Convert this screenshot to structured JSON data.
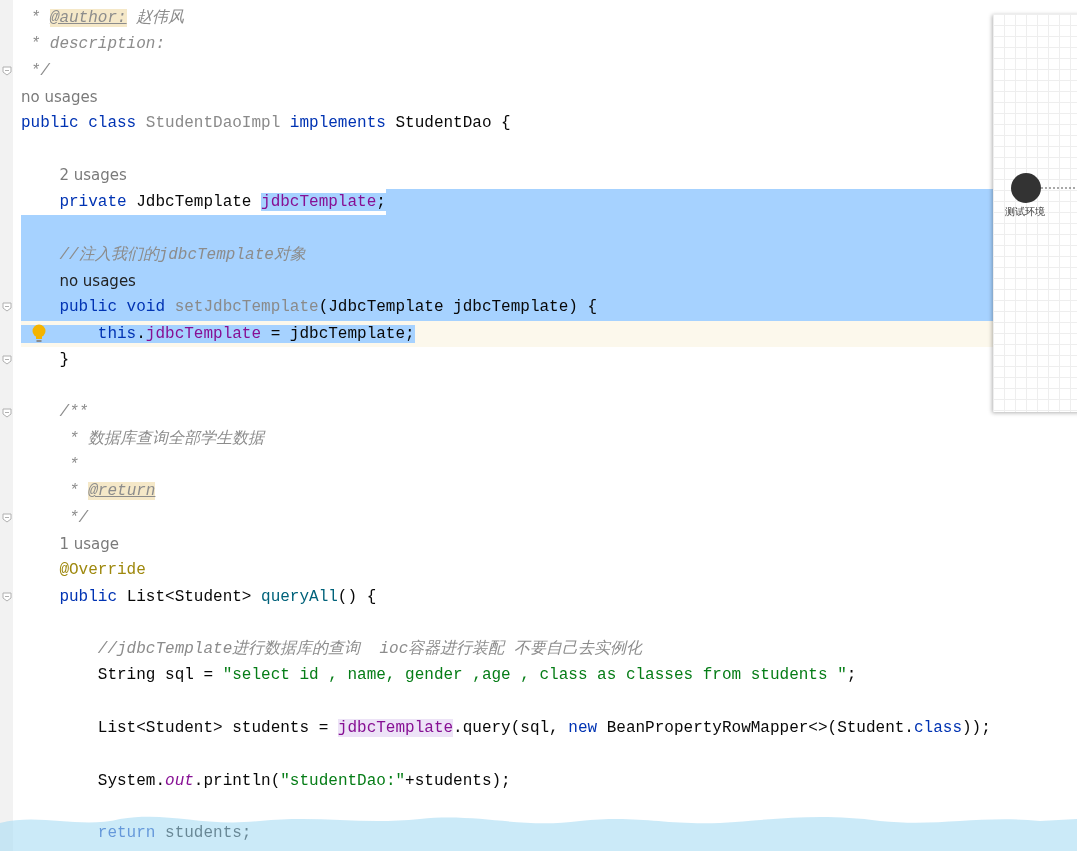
{
  "editor": {
    "lines": [
      {
        "kind": "code",
        "selected": false,
        "fold": false,
        "current": false,
        "tokens": [
          {
            "text": " * ",
            "kind": "doc"
          },
          {
            "text": "@author:",
            "kind": "doctag"
          },
          {
            "text": " 赵伟风",
            "kind": "doc"
          }
        ]
      },
      {
        "kind": "code",
        "selected": false,
        "fold": false,
        "current": false,
        "tokens": [
          {
            "text": " * description:",
            "kind": "doc"
          }
        ]
      },
      {
        "kind": "code",
        "selected": false,
        "fold": true,
        "current": false,
        "tokens": [
          {
            "text": " */",
            "kind": "doc"
          }
        ]
      },
      {
        "kind": "hint",
        "selected": false,
        "fold": false,
        "current": false,
        "text": "no usages"
      },
      {
        "kind": "code",
        "selected": false,
        "fold": false,
        "current": false,
        "tokens": [
          {
            "text": "public class ",
            "kind": "keyword"
          },
          {
            "text": "StudentDaoImpl",
            "kind": "unused"
          },
          {
            "text": " implements ",
            "kind": "keyword"
          },
          {
            "text": "StudentDao {",
            "kind": "plain"
          }
        ]
      },
      {
        "kind": "blank",
        "selected": false,
        "fold": false,
        "current": false
      },
      {
        "kind": "hint",
        "selected": false,
        "fold": false,
        "current": false,
        "text": "    2 usages"
      },
      {
        "kind": "code",
        "selected": false,
        "selected_to_end": true,
        "fold": false,
        "current": false,
        "tokens": [
          {
            "text": "    private",
            "kind": "keyword",
            "selected": false
          },
          {
            "text": " JdbcTemplate ",
            "kind": "plain",
            "selected": false
          },
          {
            "text": "jdbcTemplate",
            "kind": "field",
            "selected": true
          },
          {
            "text": ";",
            "kind": "plain",
            "selected": true
          }
        ]
      },
      {
        "kind": "blank",
        "selected": true,
        "fold": false,
        "current": false
      },
      {
        "kind": "code",
        "selected": true,
        "fold": false,
        "current": false,
        "tokens": [
          {
            "text": "    //注入我们的jdbcTemplate对象",
            "kind": "comment"
          }
        ]
      },
      {
        "kind": "hint",
        "selected": true,
        "fold": false,
        "current": false,
        "text": "    no usages"
      },
      {
        "kind": "code",
        "selected": true,
        "fold": true,
        "current": false,
        "tokens": [
          {
            "text": "    public void ",
            "kind": "keyword"
          },
          {
            "text": "setJdbcTemplate",
            "kind": "unused"
          },
          {
            "text": "(JdbcTemplate jdbcTemplate) {",
            "kind": "plain"
          }
        ]
      },
      {
        "kind": "code",
        "selected": false,
        "fold": false,
        "current": true,
        "tokens": [
          {
            "text": "        this",
            "kind": "keyword",
            "selected": true
          },
          {
            "text": ".",
            "kind": "plain",
            "selected": true
          },
          {
            "text": "jdbcTemplate",
            "kind": "field",
            "selected": true
          },
          {
            "text": " = jdbcTemplate;",
            "kind": "plain",
            "selected": true
          }
        ]
      },
      {
        "kind": "code",
        "selected": false,
        "fold": true,
        "current": false,
        "tokens": [
          {
            "text": "    }",
            "kind": "plain"
          }
        ]
      },
      {
        "kind": "blank",
        "selected": false,
        "fold": false,
        "current": false
      },
      {
        "kind": "code",
        "selected": false,
        "fold": true,
        "current": false,
        "tokens": [
          {
            "text": "    /**",
            "kind": "doc"
          }
        ]
      },
      {
        "kind": "code",
        "selected": false,
        "fold": false,
        "current": false,
        "tokens": [
          {
            "text": "     * 数据库查询全部学生数据",
            "kind": "doc"
          }
        ]
      },
      {
        "kind": "code",
        "selected": false,
        "fold": false,
        "current": false,
        "tokens": [
          {
            "text": "     *",
            "kind": "doc"
          }
        ]
      },
      {
        "kind": "code",
        "selected": false,
        "fold": false,
        "current": false,
        "tokens": [
          {
            "text": "     * ",
            "kind": "doc"
          },
          {
            "text": "@return",
            "kind": "doctag"
          }
        ]
      },
      {
        "kind": "code",
        "selected": false,
        "fold": true,
        "current": false,
        "tokens": [
          {
            "text": "     */",
            "kind": "doc"
          }
        ]
      },
      {
        "kind": "hint",
        "selected": false,
        "fold": false,
        "current": false,
        "text": "    1 usage"
      },
      {
        "kind": "code",
        "selected": false,
        "fold": false,
        "current": false,
        "tokens": [
          {
            "text": "    @Override",
            "kind": "annotation"
          }
        ]
      },
      {
        "kind": "code",
        "selected": false,
        "fold": true,
        "current": false,
        "tokens": [
          {
            "text": "    public ",
            "kind": "keyword"
          },
          {
            "text": "List<Student> ",
            "kind": "plain"
          },
          {
            "text": "queryAll",
            "kind": "method"
          },
          {
            "text": "() {",
            "kind": "plain"
          }
        ]
      },
      {
        "kind": "blank",
        "selected": false,
        "fold": false,
        "current": false
      },
      {
        "kind": "code",
        "selected": false,
        "fold": false,
        "current": false,
        "tokens": [
          {
            "text": "        //jdbcTemplate进行数据库的查询  ioc容器进行装配 不要自己去实例化",
            "kind": "comment"
          }
        ]
      },
      {
        "kind": "code",
        "selected": false,
        "fold": false,
        "current": false,
        "tokens": [
          {
            "text": "        String sql = ",
            "kind": "plain"
          },
          {
            "text": "\"select id , name, gender ,age , class as classes from students \"",
            "kind": "string"
          },
          {
            "text": ";",
            "kind": "plain"
          }
        ]
      },
      {
        "kind": "blank",
        "selected": false,
        "fold": false,
        "current": false
      },
      {
        "kind": "code",
        "selected": false,
        "fold": false,
        "current": false,
        "tokens": [
          {
            "text": "        List<Student> students = ",
            "kind": "plain"
          },
          {
            "text": "jdbcTemplate",
            "kind": "usage"
          },
          {
            "text": ".query(sql, ",
            "kind": "plain"
          },
          {
            "text": "new",
            "kind": "keyword"
          },
          {
            "text": " BeanPropertyRowMapper<>(Student.",
            "kind": "plain"
          },
          {
            "text": "class",
            "kind": "keyword"
          },
          {
            "text": "));",
            "kind": "plain"
          }
        ]
      },
      {
        "kind": "blank",
        "selected": false,
        "fold": false,
        "current": false
      },
      {
        "kind": "code",
        "selected": false,
        "fold": false,
        "current": false,
        "tokens": [
          {
            "text": "        System.",
            "kind": "plain"
          },
          {
            "text": "out",
            "kind": "static"
          },
          {
            "text": ".println(",
            "kind": "plain"
          },
          {
            "text": "\"studentDao:\"",
            "kind": "string"
          },
          {
            "text": "+students);",
            "kind": "plain"
          }
        ]
      },
      {
        "kind": "blank",
        "selected": false,
        "fold": false,
        "current": false
      },
      {
        "kind": "code",
        "selected": false,
        "fold": false,
        "current": false,
        "tokens": [
          {
            "text": "        return",
            "kind": "keyword"
          },
          {
            "text": " students;",
            "kind": "plain"
          }
        ]
      }
    ]
  },
  "diagram_preview": {
    "node_label": "测试环境"
  }
}
